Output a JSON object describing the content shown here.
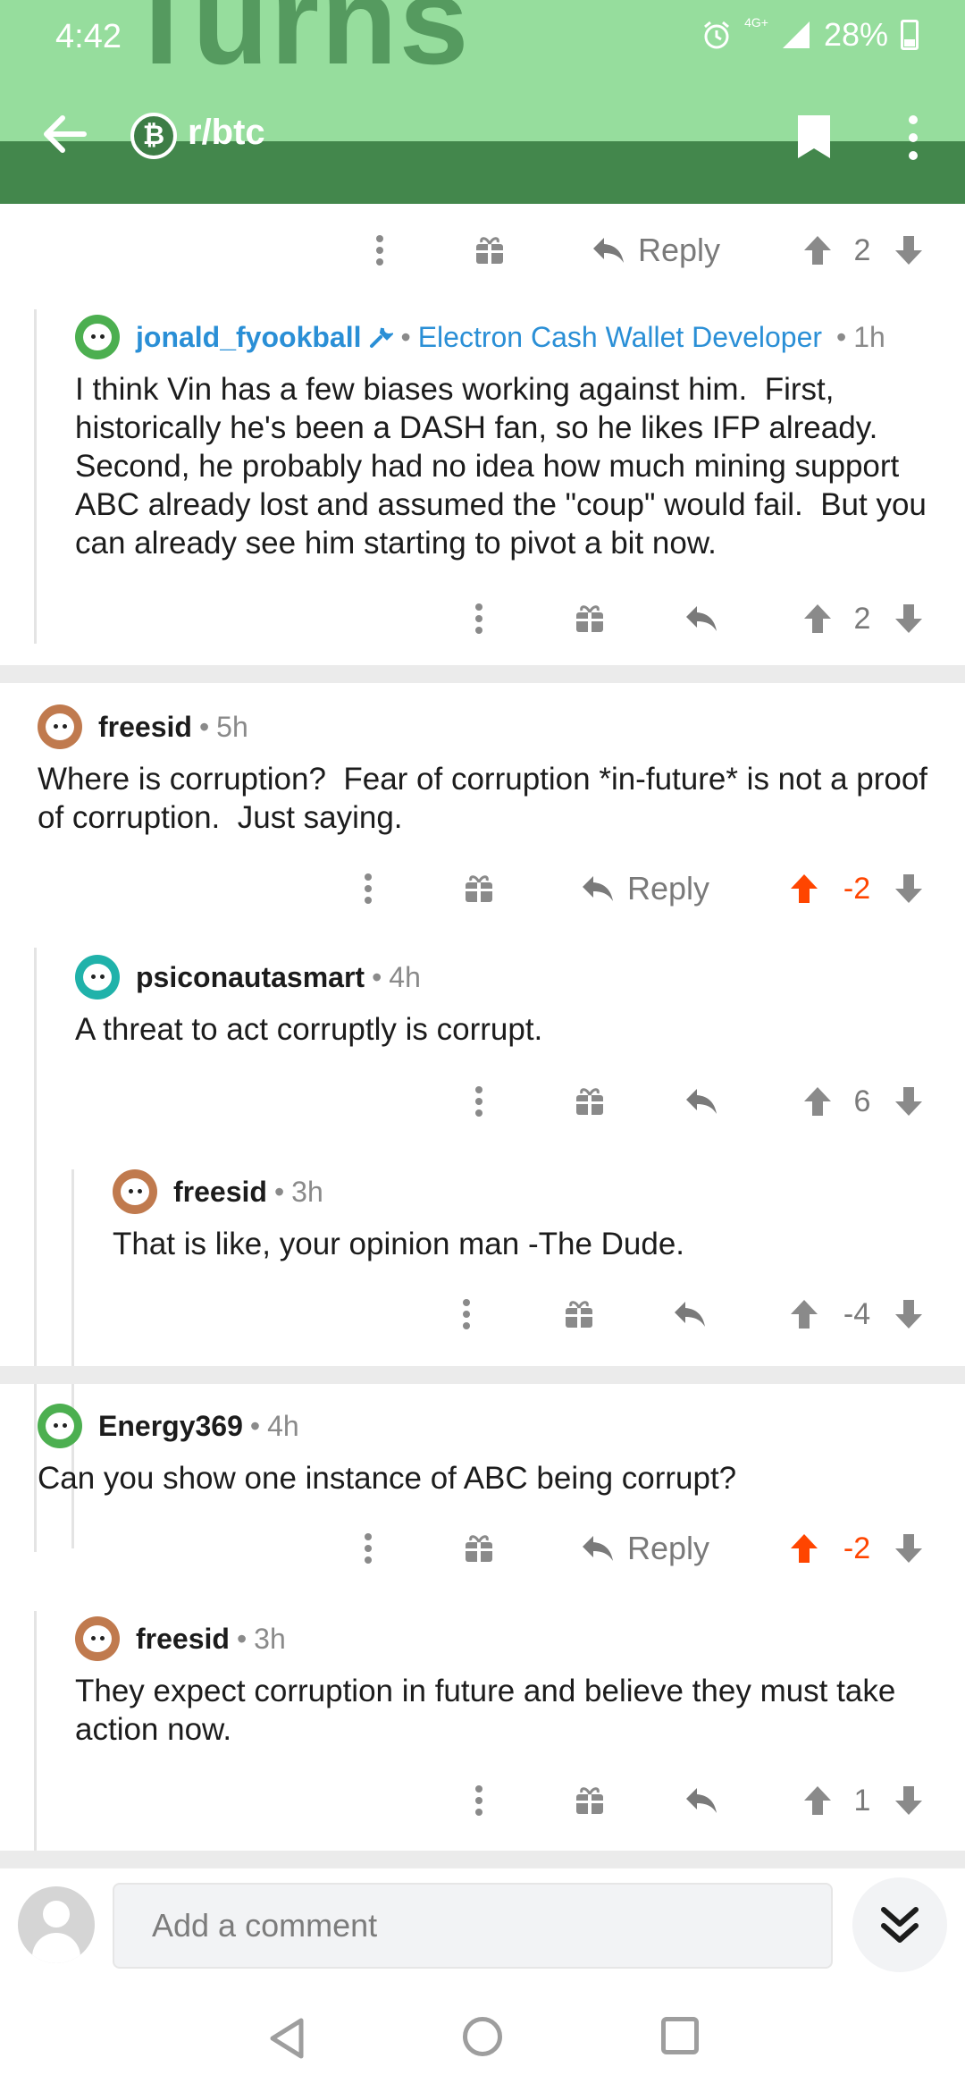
{
  "status_bar": {
    "time": "4:42",
    "network": "4G+",
    "battery": "28%"
  },
  "header": {
    "background_word": "Turns",
    "subreddit": "r/btc",
    "subreddit_icon": "bitcoin-icon"
  },
  "actions": {
    "reply_label": "Reply"
  },
  "comments": [
    {
      "author": "jonald_fyookball",
      "flair": "Electron Cash Wallet Developer",
      "age": "1h",
      "body": "I think Vin has a few biases working against him.  First, historically he's been a DASH fan, so he likes IFP already.  Second, he probably had no idea how much mining support ABC already lost and assumed the \"coup\" would fail.  But you can already see him starting to pivot a bit now.",
      "score": "2"
    },
    {
      "author": "freesid",
      "age": "5h",
      "body": "Where is corruption?  Fear of corruption *in-future* is not a proof of corruption.  Just saying.",
      "score": "-2"
    },
    {
      "author": "psiconautasmart",
      "age": "4h",
      "body": "A threat to act corruptly is corrupt.",
      "score": "6"
    },
    {
      "author": "freesid",
      "age": "3h",
      "body": "That is like, your opinion man -The Dude.",
      "score": "-4"
    },
    {
      "author": "Energy369",
      "age": "4h",
      "body": "Can you show one instance of ABC being corrupt?",
      "score": "-2"
    },
    {
      "author": "freesid",
      "age": "3h",
      "body": "They expect corruption in future and believe they must take action now.",
      "score": "1"
    }
  ],
  "top_row": {
    "score": "2"
  },
  "composer": {
    "placeholder": "Add a comment"
  },
  "colors": {
    "header_light": "#96dd9d",
    "header_dark": "#43874c",
    "upvoted": "#ff4500",
    "flair": "#2a8fd6"
  }
}
